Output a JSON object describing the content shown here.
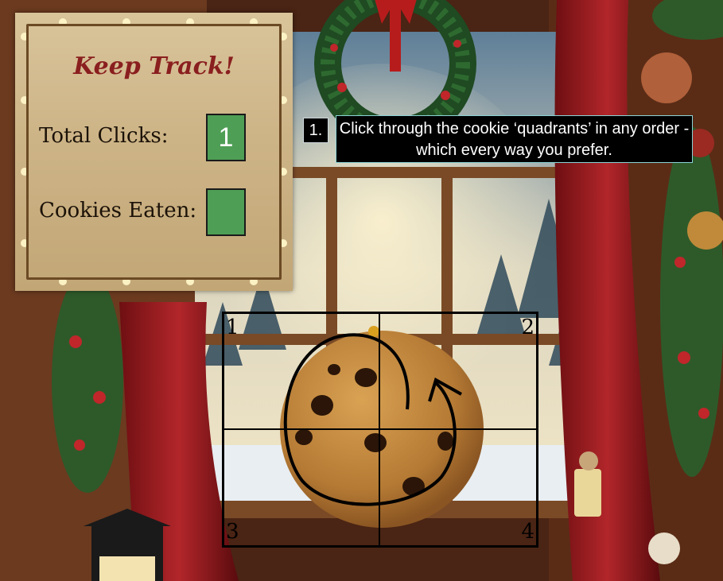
{
  "tracker": {
    "title": "Keep Track!",
    "total_clicks_label": "Total Clicks:",
    "total_clicks_value": "1",
    "cookies_eaten_label": "Cookies Eaten:",
    "cookies_eaten_value": ""
  },
  "instruction": {
    "number": "1.",
    "text": "Click through the cookie ‘quadrants’ in any order - which every way you prefer."
  },
  "quadrants": [
    {
      "label": "1"
    },
    {
      "label": "2"
    },
    {
      "label": "3"
    },
    {
      "label": "4"
    }
  ],
  "colors": {
    "counter_box": "#4e9e55",
    "title": "#8a1f1f"
  }
}
